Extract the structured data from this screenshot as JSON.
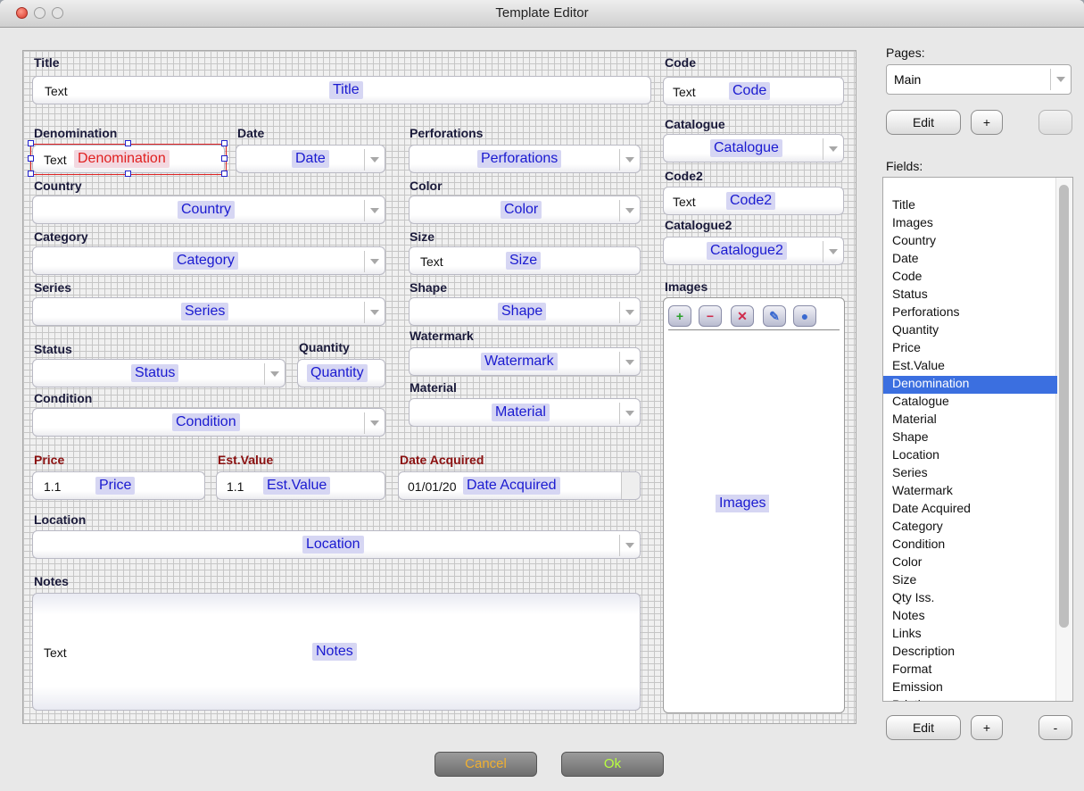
{
  "window": {
    "title": "Template Editor"
  },
  "labels": {
    "title": "Title",
    "denomination": "Denomination",
    "date": "Date",
    "perforations": "Perforations",
    "country": "Country",
    "color": "Color",
    "category": "Category",
    "size": "Size",
    "series": "Series",
    "shape": "Shape",
    "status": "Status",
    "quantity": "Quantity",
    "watermark": "Watermark",
    "condition": "Condition",
    "material": "Material",
    "price": "Price",
    "est_value": "Est.Value",
    "date_acquired": "Date Acquired",
    "location": "Location",
    "notes": "Notes",
    "code": "Code",
    "catalogue": "Catalogue",
    "code2": "Code2",
    "catalogue2": "Catalogue2",
    "images": "Images"
  },
  "fields": {
    "title": {
      "text": "Text",
      "placeholder": "Title"
    },
    "denomination": {
      "text": "Text",
      "placeholder": "Denomination"
    },
    "date": {
      "placeholder": "Date"
    },
    "perforations": {
      "placeholder": "Perforations"
    },
    "country": {
      "placeholder": "Country"
    },
    "color": {
      "placeholder": "Color"
    },
    "category": {
      "placeholder": "Category"
    },
    "size": {
      "text": "Text",
      "placeholder": "Size"
    },
    "series": {
      "placeholder": "Series"
    },
    "shape": {
      "placeholder": "Shape"
    },
    "status": {
      "placeholder": "Status"
    },
    "quantity": {
      "placeholder": "Quantity"
    },
    "watermark": {
      "placeholder": "Watermark"
    },
    "condition": {
      "placeholder": "Condition"
    },
    "material": {
      "placeholder": "Material"
    },
    "price": {
      "text": "1.1",
      "placeholder": "Price"
    },
    "est_value": {
      "text": "1.1",
      "placeholder": "Est.Value"
    },
    "date_acquired": {
      "text": "01/01/20",
      "placeholder": "Date Acquired"
    },
    "location": {
      "placeholder": "Location"
    },
    "notes": {
      "text": "Text",
      "placeholder": "Notes"
    },
    "code": {
      "text": "Text",
      "placeholder": "Code"
    },
    "catalogue": {
      "placeholder": "Catalogue"
    },
    "code2": {
      "text": "Text",
      "placeholder": "Code2"
    },
    "catalogue2": {
      "placeholder": "Catalogue2"
    },
    "images": {
      "placeholder": "Images"
    }
  },
  "image_toolbar": [
    "add-icon",
    "remove-icon",
    "delete-icon",
    "edit-icon",
    "info-icon"
  ],
  "pages": {
    "label": "Pages:",
    "selected": "Main",
    "edit": "Edit",
    "add": "+",
    "remove": "-"
  },
  "fields_panel": {
    "label": "Fields:",
    "items": [
      "Title",
      "Images",
      "Country",
      "Date",
      "Code",
      "Status",
      "Perforations",
      "Quantity",
      "Price",
      "Est.Value",
      "Denomination",
      "Catalogue",
      "Material",
      "Shape",
      "Location",
      "Series",
      "Watermark",
      "Date Acquired",
      "Category",
      "Condition",
      "Color",
      "Size",
      "Qty Iss.",
      "Notes",
      "Links",
      "Description",
      "Format",
      "Emission",
      "Printing"
    ],
    "selected": "Denomination",
    "edit": "Edit",
    "add": "+",
    "remove": "-"
  },
  "buttons": {
    "cancel": "Cancel",
    "ok": "Ok"
  },
  "colors": {
    "cancel_text": "#f0b030",
    "ok_text": "#b8ff40",
    "selection": "#3b6fe0",
    "placeholder_text": "#1a1ad0",
    "required_label": "#8b1010"
  }
}
